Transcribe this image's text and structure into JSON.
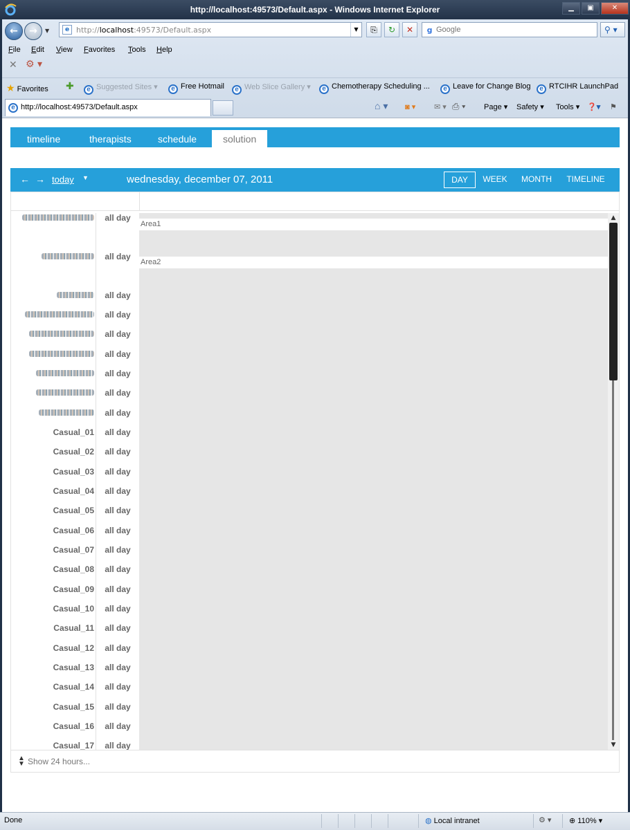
{
  "window": {
    "title": "http://localhost:49573/Default.aspx - Windows Internet Explorer"
  },
  "address": {
    "url_prefix": "http://",
    "url_host": "localhost",
    "url_rest": ":49573/Default.aspx"
  },
  "search": {
    "placeholder": "Google"
  },
  "menu": [
    "File",
    "Edit",
    "View",
    "Favorites",
    "Tools",
    "Help"
  ],
  "favorites": {
    "label": "Favorites",
    "items": [
      "Suggested Sites ▾",
      "Free Hotmail",
      "Web Slice Gallery ▾",
      "Chemotherapy Scheduling ...",
      "Leave for Change Blog",
      "RTCIHR LaunchPad"
    ]
  },
  "browser_tab": {
    "title": "http://localhost:49573/Default.aspx"
  },
  "command_bar": {
    "page": "Page ▾",
    "safety": "Safety ▾",
    "tools": "Tools ▾"
  },
  "app": {
    "tabs": [
      "timeline",
      "therapists",
      "schedule",
      "solution"
    ],
    "active_tab": "solution"
  },
  "scheduler": {
    "today_label": "today",
    "date": "wednesday, december 07, 2011",
    "views": [
      "DAY",
      "WEEK",
      "MONTH",
      "TIMELINE"
    ],
    "active_view": "DAY",
    "all_day_label": "all day",
    "areas": [
      "Area1",
      "Area2"
    ],
    "resources": [
      "Casual_01",
      "Casual_02",
      "Casual_03",
      "Casual_04",
      "Casual_05",
      "Casual_06",
      "Casual_07",
      "Casual_08",
      "Casual_09",
      "Casual_10",
      "Casual_11",
      "Casual_12",
      "Casual_13",
      "Casual_14",
      "Casual_15",
      "Casual_16",
      "Casual_17"
    ],
    "show_24_label": "Show 24 hours..."
  },
  "status": {
    "text": "Done",
    "zone": "Local intranet",
    "zoom": "110%"
  }
}
